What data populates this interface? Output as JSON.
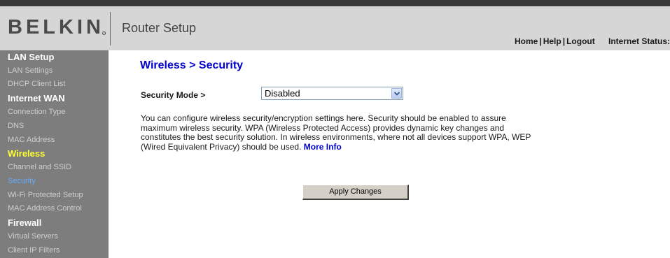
{
  "header": {
    "logo_text": "BELKIN",
    "app_title": "Router Setup",
    "links": [
      "Home",
      "Help",
      "Logout"
    ],
    "link_separator": "|",
    "internet_status_label": "Internet Status:"
  },
  "sidebar": {
    "items": [
      {
        "label": "LAN Setup",
        "type": "section"
      },
      {
        "label": "LAN Settings",
        "type": "link"
      },
      {
        "label": "DHCP Client List",
        "type": "link"
      },
      {
        "label": "Internet WAN",
        "type": "section"
      },
      {
        "label": "Connection Type",
        "type": "link"
      },
      {
        "label": "DNS",
        "type": "link"
      },
      {
        "label": "MAC Address",
        "type": "link"
      },
      {
        "label": "Wireless",
        "type": "section",
        "active": true
      },
      {
        "label": "Channel and SSID",
        "type": "link"
      },
      {
        "label": "Security",
        "type": "link",
        "active": true
      },
      {
        "label": "Wi-Fi Protected Setup",
        "type": "link"
      },
      {
        "label": "MAC Address Control",
        "type": "link"
      },
      {
        "label": "Firewall",
        "type": "section"
      },
      {
        "label": "Virtual Servers",
        "type": "link"
      },
      {
        "label": "Client IP Filters",
        "type": "link"
      }
    ]
  },
  "main": {
    "page_heading": "Wireless > Security",
    "security_mode": {
      "label": "Security Mode >",
      "selected_value": "Disabled"
    },
    "description": "You can configure wireless security/encryption settings here. Security should be enabled to assure maximum wireless security. WPA (Wireless Protected Access) provides dynamic key changes and constitutes the best security solution. In wireless environments, where not all devices support WPA, WEP (Wired Equivalent Privacy) should be used.",
    "more_info_link": "More Info",
    "apply_button_label": "Apply Changes"
  },
  "colors": {
    "heading_blue": "#0000cc",
    "sidebar_bg": "#7d7d7d",
    "active_section": "#ffff33",
    "active_link": "#66aaff",
    "header_bg": "#d6d6d6"
  },
  "icons": {
    "select_arrow": "chevron-down-icon"
  }
}
